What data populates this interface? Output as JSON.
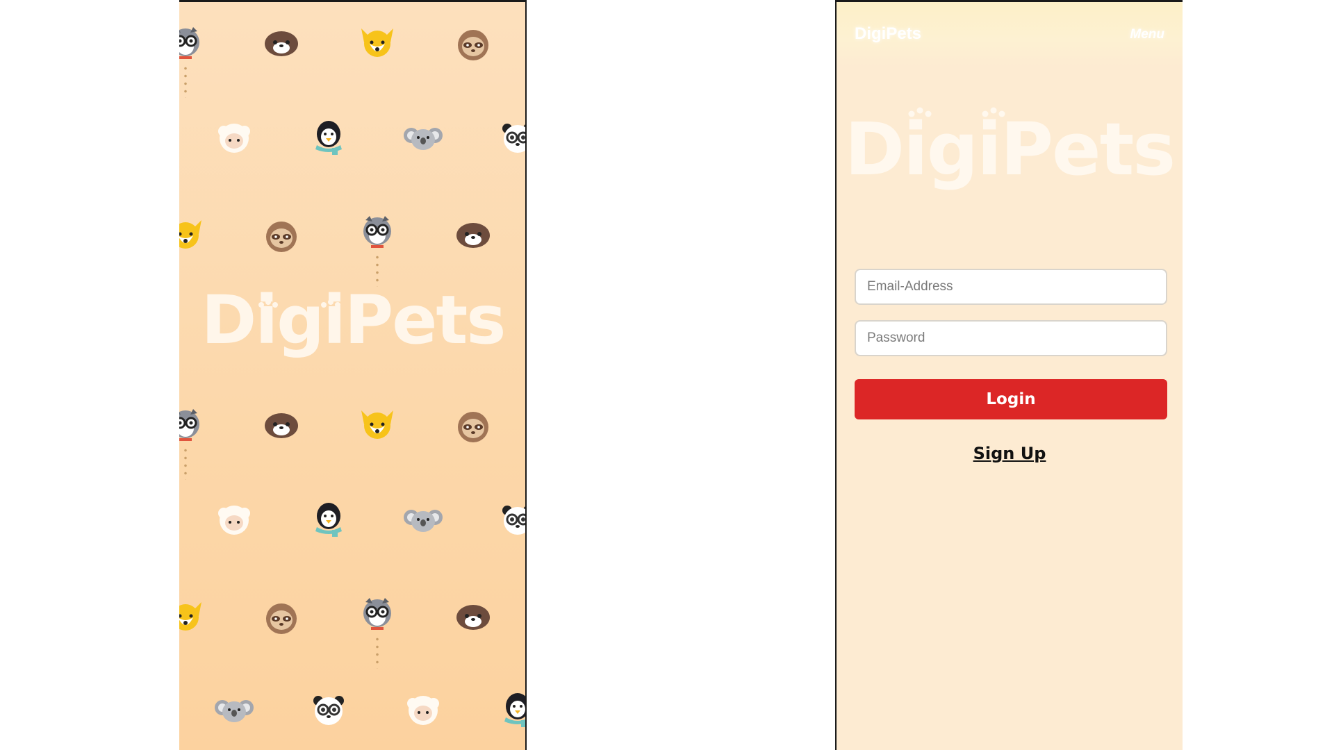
{
  "splash": {
    "logo_text": "DigiPets",
    "pattern_icons": [
      "raccoon-icon",
      "otter-icon",
      "corgi-icon",
      "sloth-icon",
      "sheep-icon",
      "penguin-icon",
      "koala-icon",
      "panda-icon"
    ]
  },
  "login": {
    "nav": {
      "brand": "DigiPets",
      "menu_label": "Menu"
    },
    "logo_text": "DigiPets",
    "email_placeholder": "Email-Address",
    "email_value": "",
    "password_placeholder": "Password",
    "password_value": "",
    "login_button": "Login",
    "signup_link": "Sign Up"
  },
  "colors": {
    "accent_button": "#dc2626",
    "splash_bg": "#fcd7a9",
    "login_bg": "#fdebd2"
  }
}
